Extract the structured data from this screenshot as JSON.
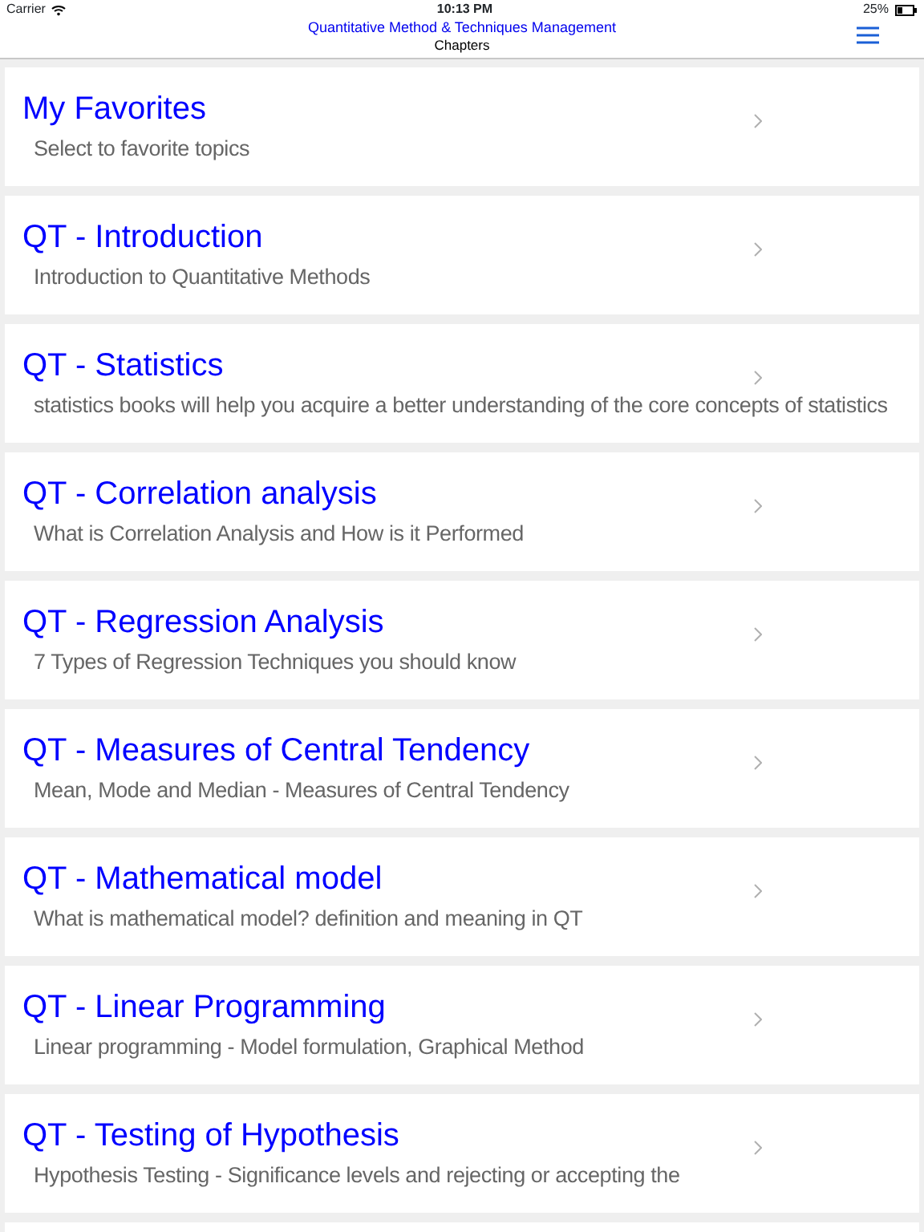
{
  "status_bar": {
    "carrier": "Carrier",
    "time": "10:13 PM",
    "battery": "25%"
  },
  "nav_bar": {
    "title": "Quantitative Method & Techniques Management",
    "subtitle": "Chapters"
  },
  "chapters": [
    {
      "title": "My Favorites",
      "subtitle": "Select to favorite topics"
    },
    {
      "title": "QT - Introduction",
      "subtitle": "Introduction to Quantitative Methods"
    },
    {
      "title": "QT - Statistics",
      "subtitle": "statistics books will help you acquire a better understanding of the core concepts of statistics"
    },
    {
      "title": "QT - Correlation analysis",
      "subtitle": "What is Correlation Analysis and How is it Performed"
    },
    {
      "title": "QT - Regression Analysis",
      "subtitle": "7 Types of Regression Techniques you should know"
    },
    {
      "title": "QT - Measures of Central Tendency",
      "subtitle": "Mean, Mode and Median - Measures of Central Tendency"
    },
    {
      "title": "QT - Mathematical model",
      "subtitle": "What is mathematical model? definition and meaning in QT"
    },
    {
      "title": "QT - Linear Programming",
      "subtitle": "Linear programming - Model formulation, Graphical Method"
    },
    {
      "title": "QT - Testing of Hypothesis",
      "subtitle": "Hypothesis Testing - Significance levels and rejecting or accepting the"
    }
  ]
}
